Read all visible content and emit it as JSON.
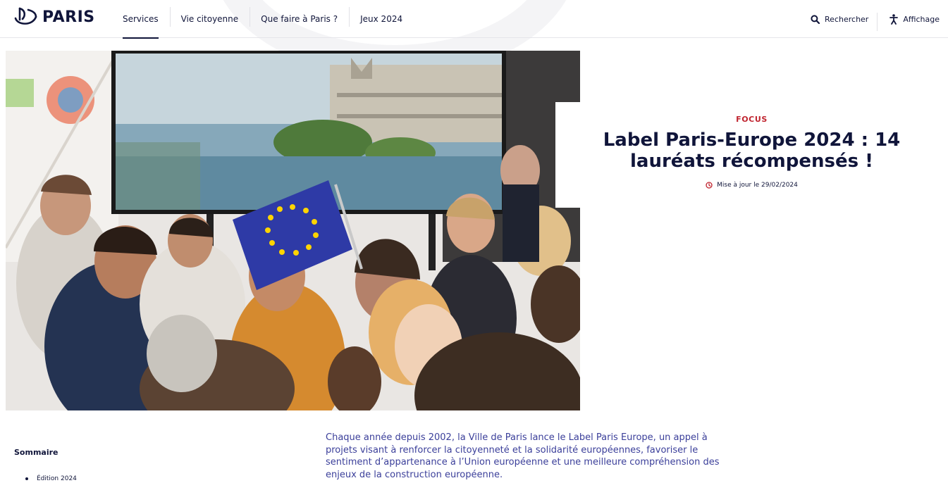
{
  "header": {
    "logo_text": "PARIS",
    "nav": [
      {
        "label": "Services",
        "active": true
      },
      {
        "label": "Vie citoyenne",
        "active": false
      },
      {
        "label": "Que faire à Paris ?",
        "active": false
      },
      {
        "label": "Jeux 2024",
        "active": false
      }
    ],
    "tools": [
      {
        "label": "Rechercher",
        "icon": "search-icon"
      },
      {
        "label": "Affichage",
        "icon": "accessibility-icon"
      }
    ]
  },
  "article": {
    "kicker": "FOCUS",
    "title": "Label Paris-Europe 2024 : 14 lauréats récompensés !",
    "updated": "Mise à jour le 29/02/2024",
    "intro": "Chaque année depuis 2002, la Ville de Paris lance le Label Paris Europe, un appel à projets visant à renforcer la citoyenneté et la solidarité européennes, favoriser le sentiment d’appartenance à l’Union européenne et une meilleure compréhension des enjeux de la construction européenne."
  },
  "summary": {
    "title": "Sommaire",
    "items": [
      {
        "label": "Édition 2024"
      }
    ]
  },
  "colors": {
    "navy": "#10153a",
    "accent_red": "#c0242f",
    "intro_blue": "#3b3f9a",
    "eu_blue": "#2e3aa6",
    "eu_gold": "#ffd400"
  }
}
